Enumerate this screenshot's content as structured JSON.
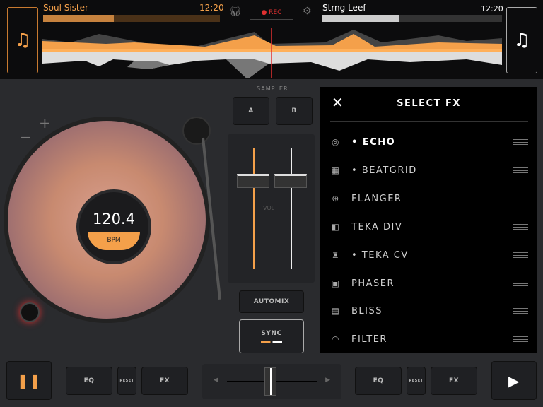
{
  "deck_left": {
    "title": "Soul Sister",
    "time": "12:20",
    "bpm": "120.4",
    "bpm_label": "BPM"
  },
  "deck_right": {
    "title": "Strng Leef",
    "time": "12:20"
  },
  "rec_label": "● REC",
  "sampler": {
    "label": "SAMPLER",
    "a": "A",
    "b": "B"
  },
  "mixer": {
    "vol_label": "VOL",
    "automix": "AUTOMIX",
    "sync": "SYNC"
  },
  "fx_panel": {
    "title": "SELECT FX",
    "items": [
      {
        "label": "• ECHO",
        "icon": "echo-icon"
      },
      {
        "label": "• BEATGRID",
        "icon": "beatgrid-icon"
      },
      {
        "label": "FLANGER",
        "icon": "flanger-icon"
      },
      {
        "label": "TEKA DIV",
        "icon": "teka-div-icon"
      },
      {
        "label": "• TEKA CV",
        "icon": "teka-cv-icon"
      },
      {
        "label": "PHASER",
        "icon": "phaser-icon"
      },
      {
        "label": "BLISS",
        "icon": "bliss-icon"
      },
      {
        "label": "FILTER",
        "icon": "filter-icon"
      }
    ]
  },
  "bottom": {
    "eq": "EQ",
    "reset": "RESET",
    "fx": "FX"
  },
  "colors": {
    "accent": "#f4a04a",
    "rec": "#e03030"
  }
}
